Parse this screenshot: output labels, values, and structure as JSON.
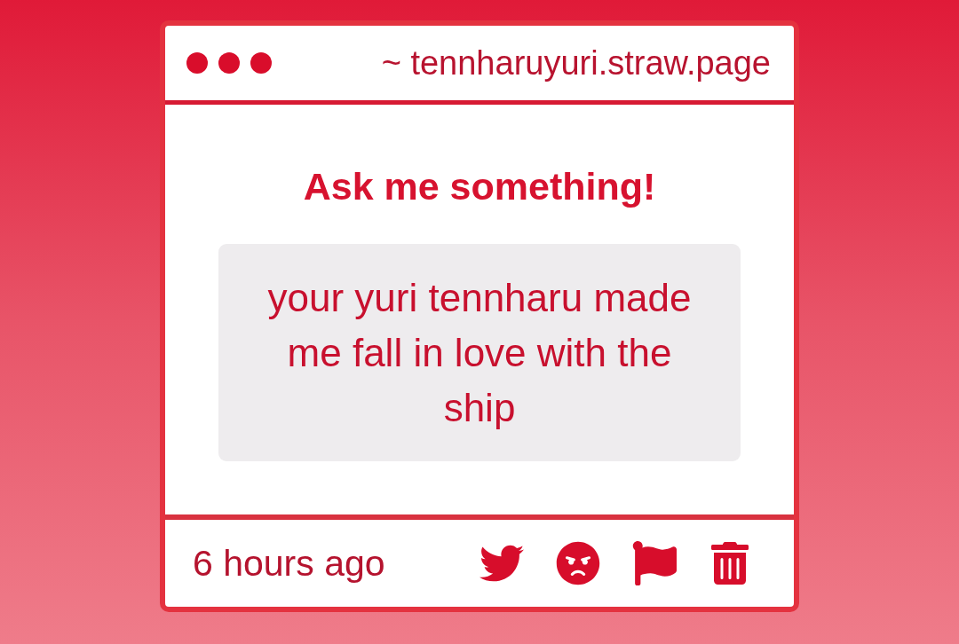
{
  "window": {
    "title": "~ tennharuyuri.straw.page"
  },
  "heading": "Ask me something!",
  "question": {
    "text": "your yuri tennharu made me fall in love with the ship"
  },
  "footer": {
    "time": "6 hours ago"
  }
}
